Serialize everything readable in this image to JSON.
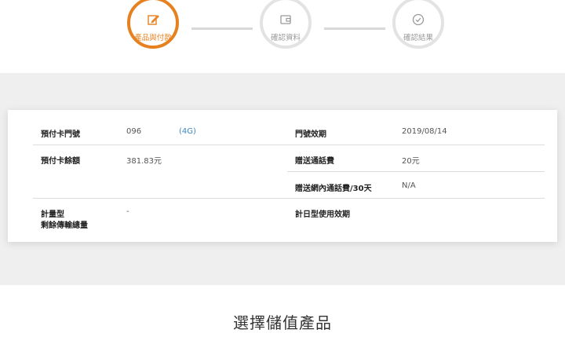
{
  "stepper": {
    "steps": [
      {
        "label": "產品與付款",
        "icon": "pencil-edit-icon",
        "state": "active"
      },
      {
        "label": "確認資料",
        "icon": "wallet-icon",
        "state": "inactive"
      },
      {
        "label": "確認結果",
        "icon": "check-circle-icon",
        "state": "inactive"
      }
    ],
    "active_color": "#e6811f",
    "inactive_color": "#e3e3e3"
  },
  "card": {
    "prepaid_number_label": "預付卡門號",
    "prepaid_number_value": "096",
    "network_type": "(4G)",
    "number_expiry_label": "門號效期",
    "number_expiry_value": "2019/08/14",
    "balance_label": "預付卡餘額",
    "balance_value": "381.83元",
    "bonus_call_label": "贈送通話費",
    "bonus_call_value": "20元",
    "bonus_onnet_label": "贈送網內通話費/30天",
    "bonus_onnet_value": "N/A",
    "metered_label_line1": "計量型",
    "metered_label_line2": "剩餘傳輸總量",
    "metered_value": "-",
    "daily_plan_label": "計日型使用效期",
    "daily_plan_value": ""
  },
  "section_heading": "選擇儲值產品"
}
